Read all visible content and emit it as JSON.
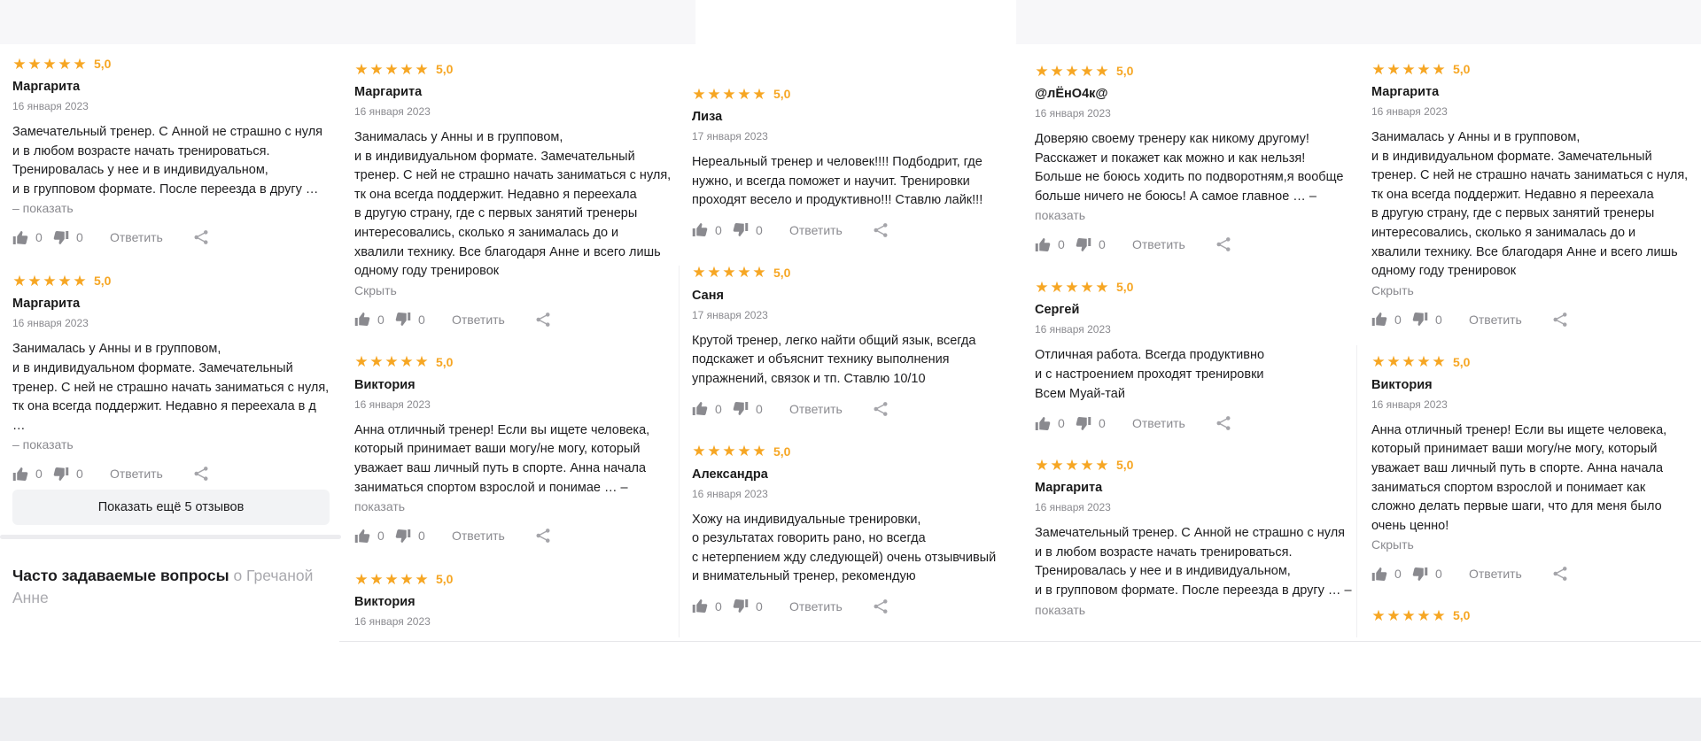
{
  "colors": {
    "star": "#f6a623",
    "muted": "#8a8a8f",
    "text": "#1d1d1f"
  },
  "icons": {
    "star": "star-icon",
    "like": "thumbs-up-icon",
    "dislike": "thumbs-down-icon",
    "share": "share-icon"
  },
  "columns": [
    {
      "reviews": [
        {
          "score": "5,0",
          "stars": 5,
          "author": "Маргарита",
          "date": "16 января 2023",
          "text": "Замечательный тренер. С Анной не страшно с нуля\nи в любом возрасте начать тренироваться.\nТренировалась у нее и в индивидуальном,\nи в групповом формате. После переезда в другу …",
          "more": "– показать",
          "likes": "0",
          "dislikes": "0",
          "reply": "Ответить"
        },
        {
          "score": "5,0",
          "stars": 5,
          "author": "Маргарита",
          "date": "16 января 2023",
          "text": "Занималась у Анны и в групповом,\nи в индивидуальном формате. Замечательный\nтренер. С ней не страшно начать заниматься с нуля,\nтк она всегда поддержит. Недавно я переехала в д\n…",
          "more": "– показать",
          "likes": "0",
          "dislikes": "0",
          "reply": "Ответить"
        }
      ]
    },
    {
      "reviews": [
        {
          "score": "5,0",
          "stars": 5,
          "author": "Маргарита",
          "date": "16 января 2023",
          "text": "Занималась у Анны и в групповом,\nи в индивидуальном формате. Замечательный\nтренер. С ней не страшно начать заниматься с нуля,\nтк она всегда поддержит. Недавно я переехала\nв другую страну, где с первых занятий тренеры\nинтересовались, сколько я занималась до и\nхвалили технику. Все благодаря Анне и всего лишь\nодному году тренировок",
          "more": "Скрыть",
          "likes": "0",
          "dislikes": "0",
          "reply": "Ответить"
        },
        {
          "score": "5,0",
          "stars": 5,
          "author": "Виктория",
          "date": "16 января 2023",
          "text": "Анна отличный тренер! Если вы ищете человека,\nкоторый принимает ваши могу/не могу, который\nуважает ваш личный путь в спорте. Анна начала\nзаниматься спортом взрослой и понимае … –",
          "more": "показать",
          "likes": "0",
          "dislikes": "0",
          "reply": "Ответить"
        },
        {
          "score": "5,0",
          "stars": 5,
          "author": "Виктория",
          "date": "16 января 2023",
          "text": "",
          "more": "",
          "likes": "",
          "dislikes": "",
          "reply": ""
        }
      ]
    },
    {
      "reviews": [
        {
          "score": "5,0",
          "stars": 5,
          "author": "Лиза",
          "date": "17 января 2023",
          "text": "Нереальный тренер и человек!!!! Подбодрит, где\nнужно, и всегда поможет и научит. Тренировки\nпроходят весело и продуктивно!!! Ставлю лайк!!!",
          "more": "",
          "likes": "0",
          "dislikes": "0",
          "reply": "Ответить"
        },
        {
          "score": "5,0",
          "stars": 5,
          "author": "Саня",
          "date": "17 января 2023",
          "text": "Крутой тренер, легко найти общий язык, всегда\nподскажет и объяснит технику выполнения\nупражнений, связок и тп. Ставлю 10/10",
          "more": "",
          "likes": "0",
          "dislikes": "0",
          "reply": "Ответить"
        },
        {
          "score": "5,0",
          "stars": 5,
          "author": "Александра",
          "date": "16 января 2023",
          "text": "Хожу на индивидуальные тренировки,\nо результатах говорить рано, но всегда\nс нетерпением жду следующей) очень отзывчивый\nи внимательный тренер, рекомендую",
          "more": "",
          "likes": "0",
          "dislikes": "0",
          "reply": "Ответить"
        }
      ]
    },
    {
      "reviews": [
        {
          "score": "5,0",
          "stars": 5,
          "author": "@лЁнО4к@",
          "date": "16 января 2023",
          "text": "Доверяю своему тренеру как никому другому!\nРасскажет и покажет как можно и как нельзя!\nБольше не боюсь ходить по подворотням,я вообще\nбольше ничего не боюсь! А самое главное … –",
          "more": "показать",
          "likes": "0",
          "dislikes": "0",
          "reply": "Ответить"
        },
        {
          "score": "5,0",
          "stars": 5,
          "author": "Сергей",
          "date": "16 января 2023",
          "text": "Отличная работа. Всегда продуктивно\nи с настроением проходят тренировки\nВсем Муай-тай",
          "more": "",
          "likes": "0",
          "dislikes": "0",
          "reply": "Ответить"
        },
        {
          "score": "5,0",
          "stars": 5,
          "author": "Маргарита",
          "date": "16 января 2023",
          "text": "Замечательный тренер. С Анной не страшно с нуля\nи в любом возрасте начать тренироваться.\nТренировалась у нее и в индивидуальном,\nи в групповом формате. После переезда в другу … –",
          "more": "показать",
          "likes": "",
          "dislikes": "",
          "reply": ""
        }
      ]
    },
    {
      "reviews": [
        {
          "score": "5,0",
          "stars": 5,
          "author": "Маргарита",
          "date": "16 января 2023",
          "text": "Занималась у Анны и в групповом,\nи в индивидуальном формате. Замечательный\nтренер. С ней не страшно начать заниматься с нуля,\nтк она всегда поддержит. Недавно я переехала\nв другую страну, где с первых занятий тренеры\nинтересовались, сколько я занималась до и\nхвалили технику. Все благодаря Анне и всего лишь\nодному году тренировок",
          "more": "Скрыть",
          "likes": "0",
          "dislikes": "0",
          "reply": "Ответить"
        },
        {
          "score": "5,0",
          "stars": 5,
          "author": "Виктория",
          "date": "16 января 2023",
          "text": "Анна отличный тренер! Если вы ищете человека,\nкоторый принимает ваши могу/не могу, который\nуважает ваш личный путь в спорте. Анна начала\nзаниматься спортом взрослой и понимает как\nсложно делать первые шаги, что для меня было\nочень ценно!",
          "more": "Скрыть",
          "likes": "0",
          "dislikes": "0",
          "reply": "Ответить"
        },
        {
          "score": "5,0",
          "stars": 5,
          "author": "",
          "date": "",
          "text": "",
          "more": "",
          "likes": "",
          "dislikes": "",
          "reply": ""
        }
      ]
    }
  ],
  "more_button": "Показать ещё 5 отзывов",
  "faq": {
    "title": "Часто задаваемые вопросы",
    "subtitle": "о Гречаной Анне"
  }
}
